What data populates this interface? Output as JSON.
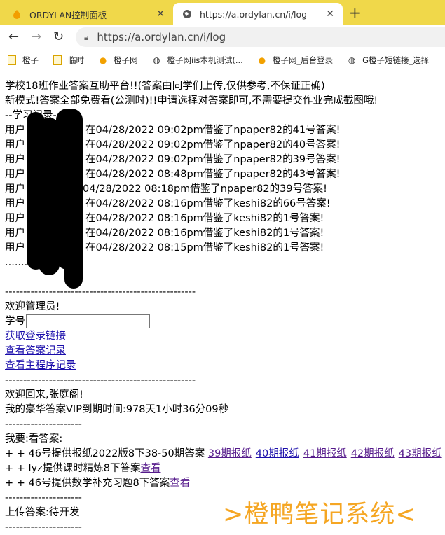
{
  "browser": {
    "tabs": [
      {
        "title": "ORDYLAN控制面板",
        "active": false
      },
      {
        "title": "https://a.ordylan.cn/i/log",
        "active": true
      }
    ],
    "url": "https://a.ordylan.cn/i/log",
    "bookmarks": [
      "橙子",
      "临时",
      "橙子网",
      "橙子网iis本机测试(...",
      "橙子网_后台登录",
      "G橙子短链接_选择"
    ]
  },
  "page": {
    "intro1": "学校18班作业答案互助平台!!(答案由同学们上传,仅供参考,不保证正确)",
    "intro2": "新模式!答案全部免费看(公测时)!!申请选择对答案即可,不需要提交作业完成截图哦!",
    "log_header": "--学习记录--",
    "records": [
      {
        "prefix": "用户",
        "text": "在04/28/2022 09:02pm借鉴了npaper82的41号答案!"
      },
      {
        "prefix": "用户",
        "text": "在04/28/2022 09:02pm借鉴了npaper82的40号答案!"
      },
      {
        "prefix": "用户",
        "text": "在04/28/2022 09:02pm借鉴了npaper82的39号答案!"
      },
      {
        "prefix": "用户",
        "text": "在04/28/2022 08:48pm借鉴了npaper82的43号答案!"
      },
      {
        "prefix": "用户",
        "text": "04/28/2022 08:18pm借鉴了npaper82的39号答案!"
      },
      {
        "prefix": "用户",
        "text": "在04/28/2022 08:16pm借鉴了keshi82的66号答案!"
      },
      {
        "prefix": "用户",
        "text": "在04/28/2022 08:16pm借鉴了keshi82的1号答案!"
      },
      {
        "prefix": "用户",
        "text": "在04/28/2022 08:16pm借鉴了keshi82的1号答案!"
      },
      {
        "prefix": "用户",
        "text": "在04/28/2022 08:15pm借鉴了keshi82的1号答案!"
      }
    ],
    "ellipsis": "........",
    "divider_long": "----------------------------------------------------",
    "welcome_admin": "欢迎管理员!",
    "student_id_label": "学号",
    "student_id_value": "",
    "link_login": "获取登录链接",
    "link_answer_records": "查看答案记录",
    "link_miniprogram_records": "查看主程序记录",
    "welcome_back": "欢迎回来,张庭阁!",
    "vip_expiry": "我的豪华答案VIP到期时间:978天1小时36分09秒",
    "divider_short": "---------------------",
    "want_answers": "我要:看答案:",
    "offers": [
      {
        "text": "+ + 46号提供报纸2022版8下38-50期答案 ",
        "links": [
          "39期报纸",
          "40期报纸",
          "41期报纸",
          "42期报纸",
          "43期报纸"
        ]
      },
      {
        "text": "+ + lyz提供课时精炼8下答案",
        "links": [
          "查看"
        ]
      },
      {
        "text": "+ + 46号提供数学补充习题8下答案",
        "links": [
          "查看"
        ]
      }
    ],
    "upload": "上传答案:待开发",
    "watermark": ">橙鸭笔记系统<"
  }
}
